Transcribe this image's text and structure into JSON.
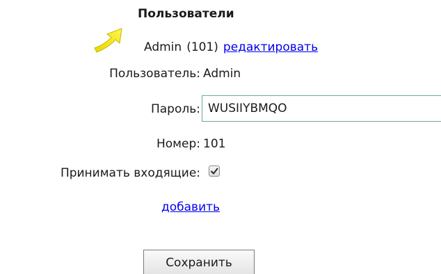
{
  "section": {
    "title": "Пользователи"
  },
  "user_entry": {
    "name": "Admin",
    "number_display": "(101)",
    "edit_link": "редактировать"
  },
  "form": {
    "username_label": "Пользователь:",
    "username_value": "Admin",
    "password_label": "Пароль:",
    "password_value": "WUSIIYBMQO",
    "number_label": "Номер:",
    "number_value": "101",
    "incoming_label": "Принимать входящие:",
    "incoming_checked": true,
    "add_link": "добавить",
    "save_button": "Сохранить"
  },
  "icons": {
    "pointer": "arrow-icon",
    "checkbox": "checkmark-icon"
  },
  "colors": {
    "link": "#0000ee",
    "arrow": "#f2e600",
    "input_border": "#6aa8a2"
  }
}
